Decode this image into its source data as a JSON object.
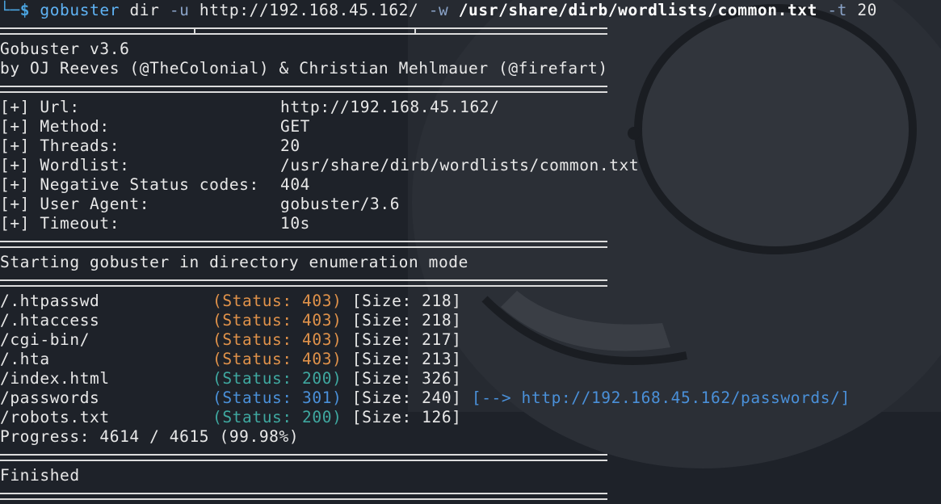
{
  "command": {
    "prompt_corner": "└─",
    "prompt_symbol": "$",
    "program": "gobuster",
    "subcommand": "dir",
    "flag_url": "-u",
    "url": "http://192.168.45.162/",
    "flag_wordlist": "-w",
    "wordlist": "/usr/share/dirb/wordlists/common.txt",
    "flag_threads": "-t",
    "threads": "20"
  },
  "banner": {
    "version": "Gobuster v3.6",
    "authors": "by OJ Reeves (@TheColonial) & Christian Mehlmauer (@firefart)"
  },
  "config": [
    {
      "label": "[+] Url:",
      "value": "http://192.168.45.162/"
    },
    {
      "label": "[+] Method:",
      "value": "GET"
    },
    {
      "label": "[+] Threads:",
      "value": "20"
    },
    {
      "label": "[+] Wordlist:",
      "value": "/usr/share/dirb/wordlists/common.txt"
    },
    {
      "label": "[+] Negative Status codes:",
      "value": "404"
    },
    {
      "label": "[+] User Agent:",
      "value": "gobuster/3.6"
    },
    {
      "label": "[+] Timeout:",
      "value": "10s"
    }
  ],
  "start_message": "Starting gobuster in directory enumeration mode",
  "results": [
    {
      "path": "/.htpasswd",
      "status": "(Status: 403)",
      "size": "[Size: 218]",
      "redirect": ""
    },
    {
      "path": "/.htaccess",
      "status": "(Status: 403)",
      "size": "[Size: 218]",
      "redirect": ""
    },
    {
      "path": "/cgi-bin/",
      "status": "(Status: 403)",
      "size": "[Size: 217]",
      "redirect": ""
    },
    {
      "path": "/.hta",
      "status": "(Status: 403)",
      "size": "[Size: 213]",
      "redirect": ""
    },
    {
      "path": "/index.html",
      "status": "(Status: 200)",
      "size": "[Size: 326]",
      "redirect": ""
    },
    {
      "path": "/passwords",
      "status": "(Status: 301)",
      "size": "[Size: 240]",
      "redirect": "[--> http://192.168.45.162/passwords/]"
    },
    {
      "path": "/robots.txt",
      "status": "(Status: 200)",
      "size": "[Size: 126]",
      "redirect": ""
    }
  ],
  "progress": "Progress: 4614 / 4615 (99.98%)",
  "finished": "Finished",
  "colors": {
    "background": "#1e2229",
    "status_403": "#e0924a",
    "status_200": "#3fa8a0",
    "status_301": "#4a90d9",
    "prompt": "#4aa3df"
  }
}
